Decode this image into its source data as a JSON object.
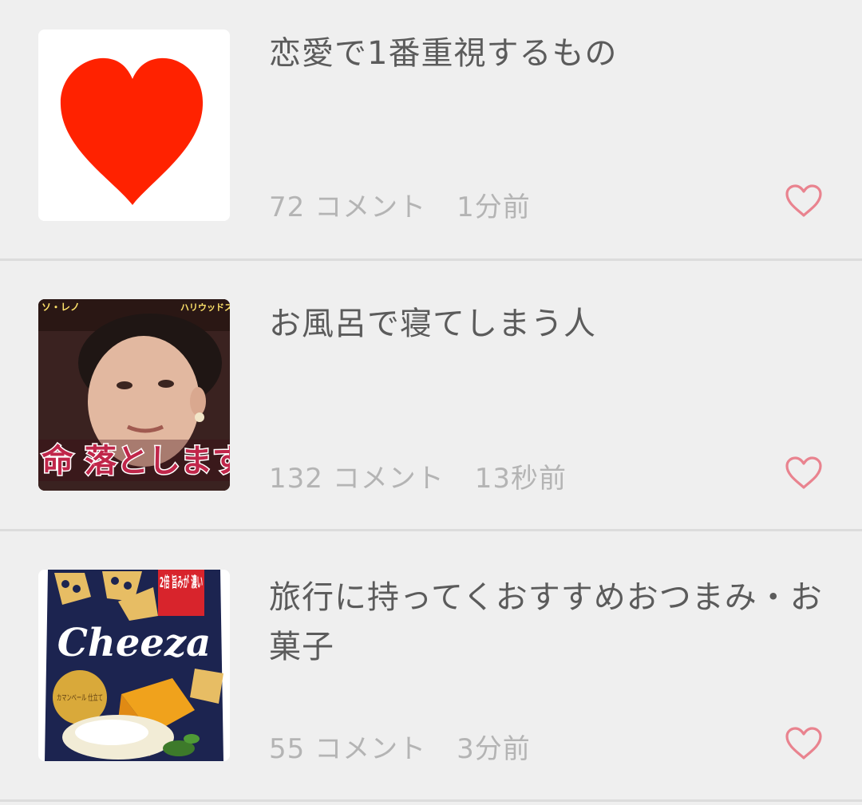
{
  "topics": [
    {
      "title": "恋愛で1番重視するもの",
      "comment_count": "72 コメント",
      "time": "1分前",
      "thumbnail": "red-heart-image"
    },
    {
      "title": "お風呂で寝てしまう人",
      "comment_count": "132 コメント",
      "time": "13秒前",
      "thumbnail": "tv-screenshot-woman",
      "thumbnail_caption": "命 落とします",
      "thumbnail_top_left": "ソ・レノ",
      "thumbnail_top_right": "ハリウッドスター"
    },
    {
      "title": "旅行に持ってくおすすめおつまみ・お菓子",
      "comment_count": "55 コメント",
      "time": "3分前",
      "thumbnail": "cheeza-snack-package",
      "thumbnail_brand": "Cheeza",
      "thumbnail_badge": "2倍 旨みが 濃い",
      "thumbnail_sub": "カマンベール 仕立て"
    }
  ],
  "colors": {
    "background": "#efefef",
    "title_text": "#5b5b5b",
    "meta_text": "#b4b4b4",
    "favorite_icon": "#e9838f",
    "divider": "#dcdcdc"
  },
  "icons": {
    "favorite": "heart-outline-icon"
  }
}
